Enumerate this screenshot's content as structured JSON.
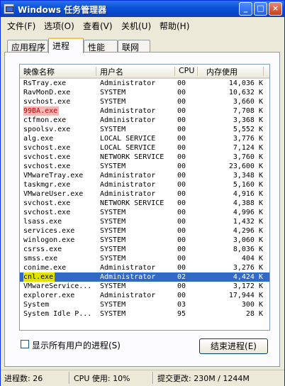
{
  "window": {
    "title": "Windows 任务管理器",
    "minimize_glyph": "_",
    "maximize_glyph": "□",
    "close_glyph": "×"
  },
  "menu": [
    "文件(F)",
    "选项(O)",
    "查看(V)",
    "关机(U)",
    "帮助(H)"
  ],
  "tabs": [
    "应用程序",
    "进程",
    "性能",
    "联网"
  ],
  "active_tab": "进程",
  "columns": {
    "name": "映像名称",
    "user": "用户名",
    "cpu": "CPU",
    "mem": "内存使用"
  },
  "processes": [
    {
      "name": "RsTray.exe",
      "user": "Administrator",
      "cpu": "00",
      "mem": "14,036 K"
    },
    {
      "name": "RavMonD.exe",
      "user": "SYSTEM",
      "cpu": "00",
      "mem": "10,632 K"
    },
    {
      "name": "svchost.exe",
      "user": "SYSTEM",
      "cpu": "00",
      "mem": "3,660 K"
    },
    {
      "name": "99BA.exe",
      "user": "Administrator",
      "cpu": "00",
      "mem": "7,708 K"
    },
    {
      "name": "ctfmon.exe",
      "user": "Administrator",
      "cpu": "00",
      "mem": "3,368 K"
    },
    {
      "name": "spoolsv.exe",
      "user": "SYSTEM",
      "cpu": "00",
      "mem": "5,552 K"
    },
    {
      "name": "alg.exe",
      "user": "LOCAL SERVICE",
      "cpu": "00",
      "mem": "3,776 K"
    },
    {
      "name": "svchost.exe",
      "user": "LOCAL SERVICE",
      "cpu": "00",
      "mem": "7,124 K"
    },
    {
      "name": "svchost.exe",
      "user": "NETWORK SERVICE",
      "cpu": "00",
      "mem": "3,760 K"
    },
    {
      "name": "svchost.exe",
      "user": "SYSTEM",
      "cpu": "00",
      "mem": "23,600 K"
    },
    {
      "name": "VMwareTray.exe",
      "user": "Administrator",
      "cpu": "00",
      "mem": "3,348 K"
    },
    {
      "name": "taskmgr.exe",
      "user": "Administrator",
      "cpu": "00",
      "mem": "5,160 K"
    },
    {
      "name": "VMwareUser.exe",
      "user": "Administrator",
      "cpu": "00",
      "mem": "4,916 K"
    },
    {
      "name": "svchost.exe",
      "user": "NETWORK SERVICE",
      "cpu": "00",
      "mem": "4,388 K"
    },
    {
      "name": "svchost.exe",
      "user": "SYSTEM",
      "cpu": "00",
      "mem": "4,996 K"
    },
    {
      "name": "lsass.exe",
      "user": "SYSTEM",
      "cpu": "00",
      "mem": "1,432 K"
    },
    {
      "name": "services.exe",
      "user": "SYSTEM",
      "cpu": "00",
      "mem": "4,296 K"
    },
    {
      "name": "winlogon.exe",
      "user": "SYSTEM",
      "cpu": "00",
      "mem": "3,060 K"
    },
    {
      "name": "csrss.exe",
      "user": "SYSTEM",
      "cpu": "00",
      "mem": "8,036 K"
    },
    {
      "name": "smss.exe",
      "user": "SYSTEM",
      "cpu": "00",
      "mem": "404 K"
    },
    {
      "name": "conime.exe",
      "user": "Administrator",
      "cpu": "00",
      "mem": "3,276 K"
    },
    {
      "name": "cnl.exe",
      "user": "Administrator",
      "cpu": "02",
      "mem": "4,424 K"
    },
    {
      "name": "VMwareService...",
      "user": "SYSTEM",
      "cpu": "00",
      "mem": "3,172 K"
    },
    {
      "name": "explorer.exe",
      "user": "Administrator",
      "cpu": "00",
      "mem": "17,944 K"
    },
    {
      "name": "System",
      "user": "SYSTEM",
      "cpu": "03",
      "mem": "300 K"
    },
    {
      "name": "System Idle P...",
      "user": "SYSTEM",
      "cpu": "95",
      "mem": "28 K"
    }
  ],
  "selected_process": "cnl.exe",
  "highlighted_names": {
    "red": "99BA.exe",
    "yellow": "cnl.exe"
  },
  "colors": {
    "selection": "#316ac5",
    "red_highlight": "#f7b6b6",
    "yellow_highlight": "#e3e300",
    "titlebar": "#0a50d6"
  },
  "show_all_users": {
    "label": "显示所有用户的进程(S)",
    "checked": false
  },
  "end_process_button": "结束进程(E)",
  "status": {
    "processes": "进程数: 26",
    "cpu": "CPU 使用: 10%",
    "commit": "提交更改: 230M / 1244M"
  }
}
